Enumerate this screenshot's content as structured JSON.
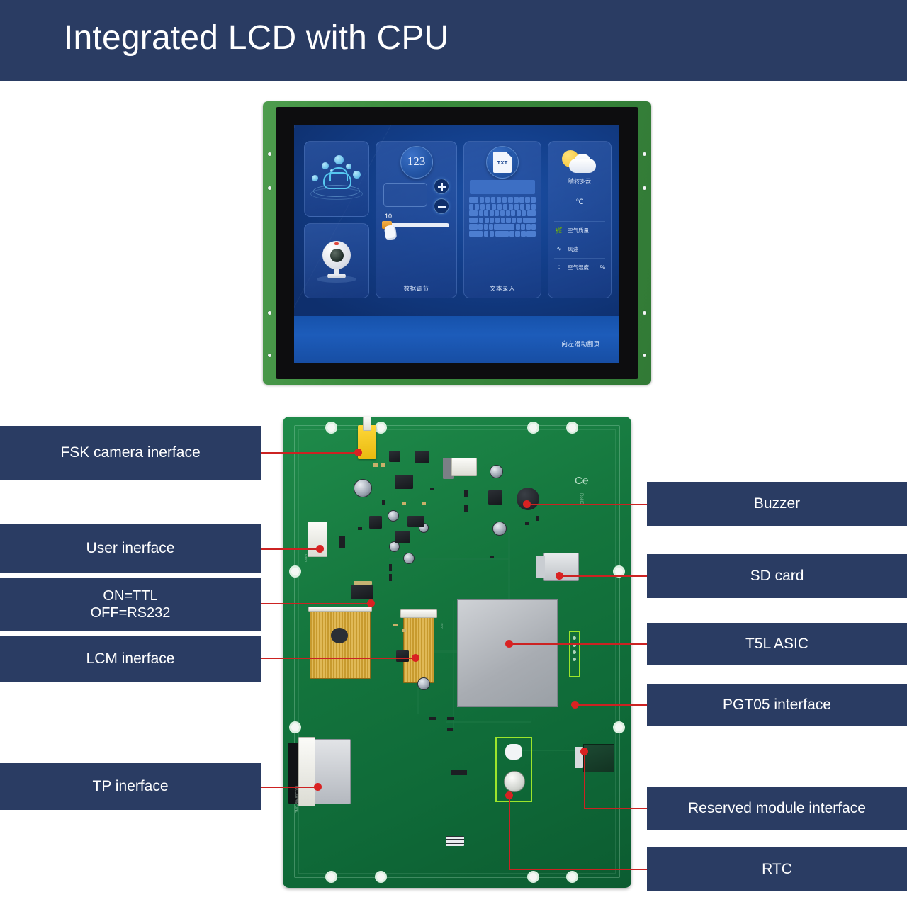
{
  "header": {
    "title": "Integrated LCD with CPU",
    "bg": "#2a3c63"
  },
  "colors": {
    "label_bg": "#2a3c63",
    "leader_line": "#cc2222",
    "pcb_green": "#14753d",
    "screen_blue": "#133f8b"
  },
  "lcd_demo": {
    "tiles": [
      {
        "name": "iot-cloud-tile",
        "caption": ""
      },
      {
        "name": "camera-tile",
        "caption": ""
      },
      {
        "name": "data-adjust-tile",
        "caption": "数据调节",
        "button_label": "123",
        "slider_value": "10"
      },
      {
        "name": "text-entry-tile",
        "caption": "文本录入",
        "button_label": "TXT"
      },
      {
        "name": "weather-tile",
        "condition": "晴转多云",
        "temp_unit": "℃",
        "rows": [
          {
            "icon": "leaf-icon",
            "label": "空气质量",
            "value": ""
          },
          {
            "icon": "wind-icon",
            "label": "风速",
            "value": ""
          },
          {
            "icon": "humidity-icon",
            "label": "空气湿度",
            "value": "%"
          }
        ]
      }
    ],
    "swipe_hint": "向左滑动翻页"
  },
  "callouts": {
    "left": [
      {
        "id": "fsk-camera-interface",
        "label": "FSK camera inerface"
      },
      {
        "id": "user-interface",
        "label": "User inerface"
      },
      {
        "id": "ttl-rs232-switch",
        "label": "ON=TTL\nOFF=RS232",
        "line1": "ON=TTL",
        "line2": "OFF=RS232"
      },
      {
        "id": "lcm-interface",
        "label": "LCM inerface"
      },
      {
        "id": "tp-interface",
        "label": "TP inerface"
      }
    ],
    "right": [
      {
        "id": "buzzer",
        "label": "Buzzer"
      },
      {
        "id": "sd-card",
        "label": "SD card"
      },
      {
        "id": "t5l-asic",
        "label": "T5L ASIC"
      },
      {
        "id": "pgt05-interface",
        "label": "PGT05 interface"
      },
      {
        "id": "reserved-module-interface",
        "label": "Reserved module interface"
      },
      {
        "id": "rtc",
        "label": "RTC"
      }
    ]
  }
}
